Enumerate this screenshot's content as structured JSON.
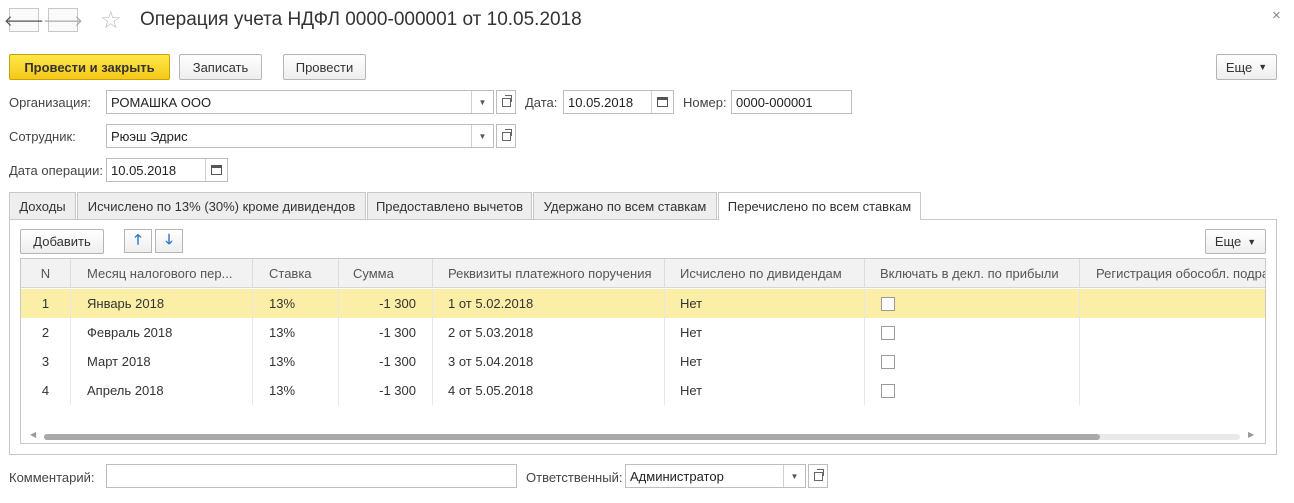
{
  "window": {
    "title": "Операция учета НДФЛ 0000-000001 от 10.05.2018",
    "back_glyph": "🡐",
    "forward_glyph": "🡒",
    "favorite_glyph": "☆",
    "close_glyph": "×"
  },
  "toolbar": {
    "post_close_label": "Провести и закрыть",
    "save_label": "Записать",
    "post_label": "Провести",
    "more_label": "Еще"
  },
  "form": {
    "org_label": "Организация:",
    "org_value": "РОМАШКА ООО",
    "date_label": "Дата:",
    "date_value": "10.05.2018",
    "number_label": "Номер:",
    "number_value": "0000-000001",
    "employee_label": "Сотрудник:",
    "employee_value": "Рюэш Эдрис",
    "op_date_label": "Дата операции:",
    "op_date_value": "10.05.2018"
  },
  "tabs": [
    {
      "label": "Доходы"
    },
    {
      "label": "Исчислено по 13% (30%) кроме дивидендов"
    },
    {
      "label": "Предоставлено вычетов"
    },
    {
      "label": "Удержано по всем ставкам"
    },
    {
      "label": "Перечислено по всем ставкам",
      "active": true
    }
  ],
  "table_toolbar": {
    "add_label": "Добавить",
    "up_glyph": "🡑",
    "down_glyph": "🡓",
    "more_label": "Еще"
  },
  "table": {
    "columns": [
      "N",
      "Месяц налогового пер...",
      "Ставка",
      "Сумма",
      "Реквизиты платежного поручения",
      "Исчислено по дивидендам",
      "Включать в декл. по прибыли",
      "Регистрация обособл. подра"
    ],
    "rows": [
      {
        "n": "1",
        "month": "Январь 2018",
        "rate": "13%",
        "sum": "-1 300",
        "payment": "1 от 5.02.2018",
        "dividends": "Нет",
        "include": false,
        "selected": true
      },
      {
        "n": "2",
        "month": "Февраль 2018",
        "rate": "13%",
        "sum": "-1 300",
        "payment": "2 от 5.03.2018",
        "dividends": "Нет",
        "include": false,
        "selected": false
      },
      {
        "n": "3",
        "month": "Март 2018",
        "rate": "13%",
        "sum": "-1 300",
        "payment": "3 от 5.04.2018",
        "dividends": "Нет",
        "include": false,
        "selected": false
      },
      {
        "n": "4",
        "month": "Апрель 2018",
        "rate": "13%",
        "sum": "-1 300",
        "payment": "4 от 5.05.2018",
        "dividends": "Нет",
        "include": false,
        "selected": false
      }
    ]
  },
  "footer": {
    "comment_label": "Комментарий:",
    "comment_value": "",
    "responsible_label": "Ответственный:",
    "responsible_value": "Администратор"
  },
  "colors": {
    "primary_button": "#f5c818",
    "selected_row": "#fbefa7",
    "arrow_blue": "#2a78c8"
  }
}
